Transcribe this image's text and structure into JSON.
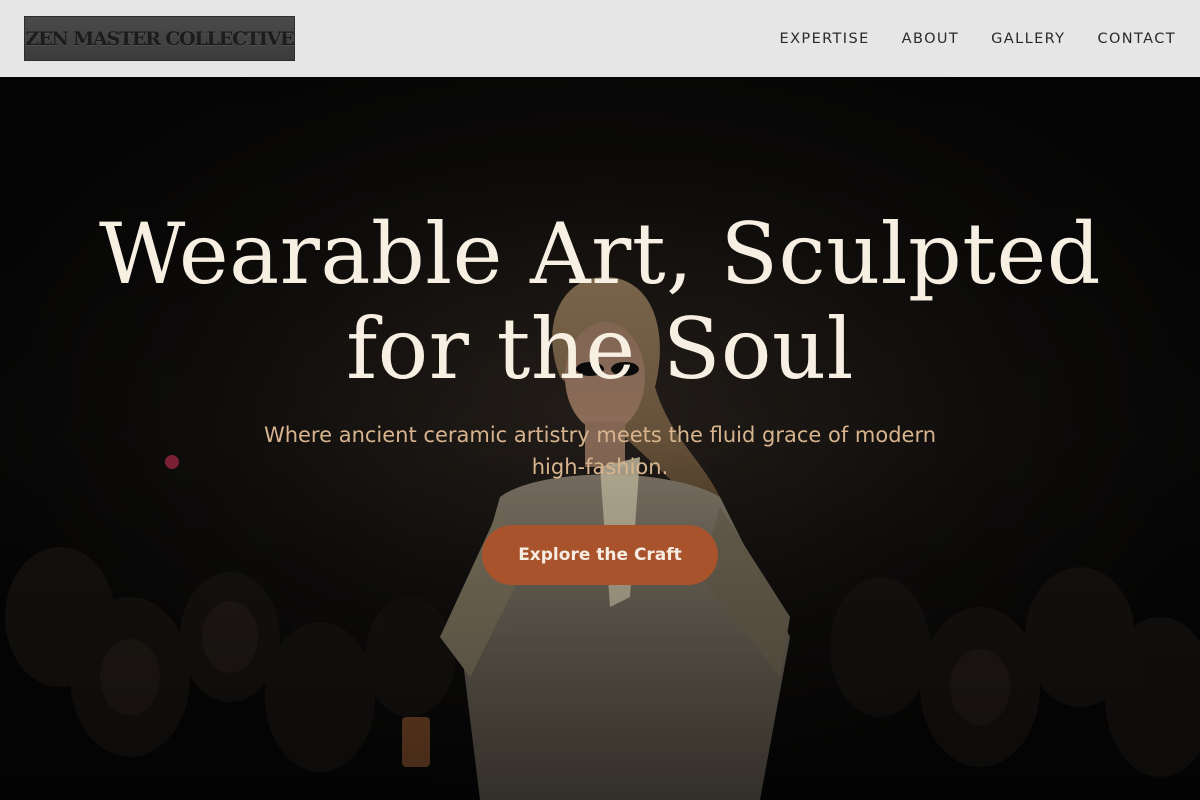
{
  "header": {
    "logo_text": "ZEN MASTER COLLECTIVE",
    "nav": [
      "EXPERTISE",
      "ABOUT",
      "GALLERY",
      "CONTACT"
    ]
  },
  "hero": {
    "title": "Wearable Art, Sculpted for the Soul",
    "subtitle": "Where ancient ceramic artistry meets the fluid grace of modern high-fashion.",
    "cta_label": "Explore the Craft",
    "image_description": "runway-model-photo"
  },
  "colors": {
    "header_bg": "#e6e6e6",
    "title": "#f6efe2",
    "subtitle": "#d8b48e",
    "cta_bg": "#a8532c",
    "cta_text": "#f7ece1"
  }
}
